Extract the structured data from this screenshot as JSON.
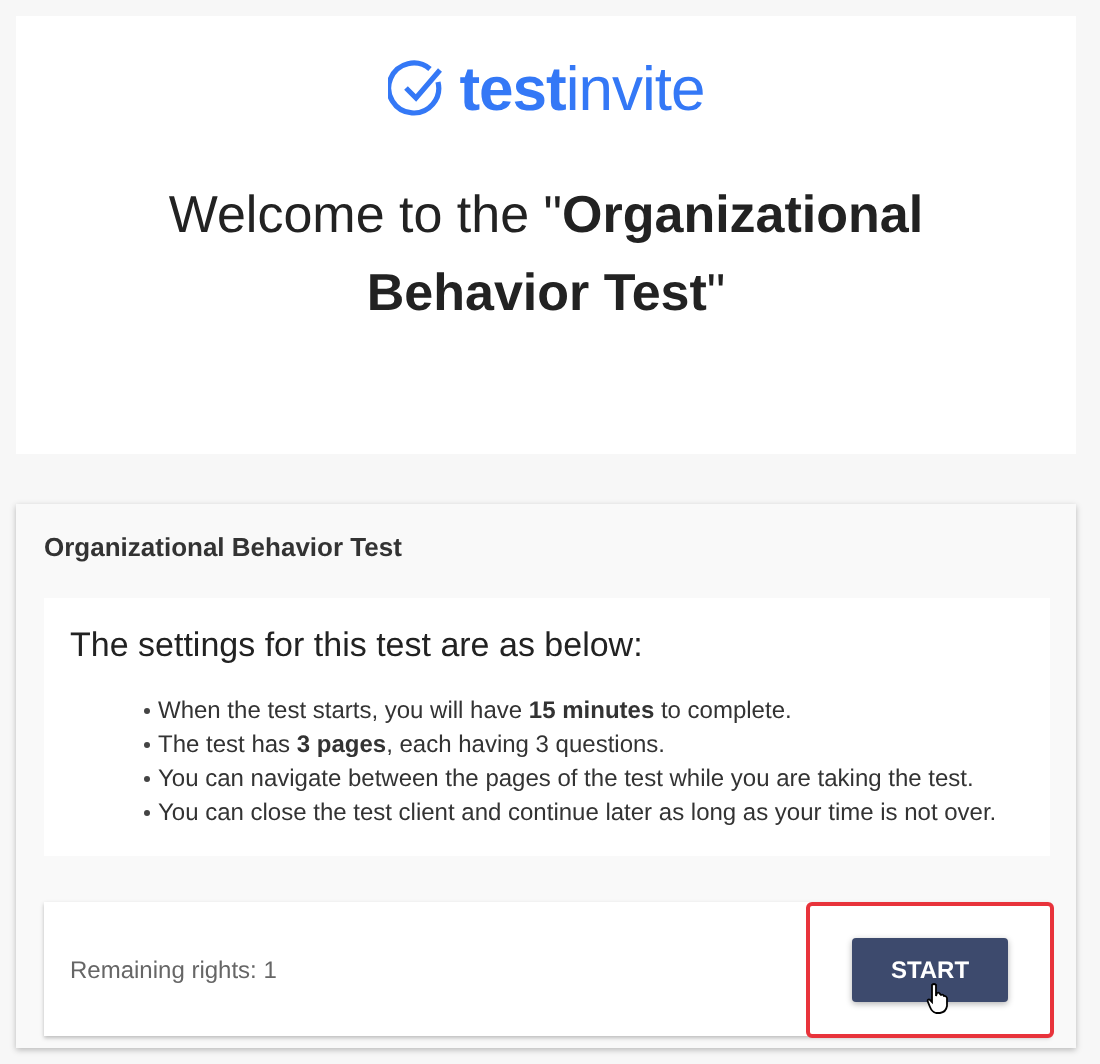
{
  "logo": {
    "text": "**test**invite"
  },
  "welcome": {
    "heading": "Welcome to the \"**Organizational Behavior Test**\""
  },
  "test_card": {
    "title": "Organizational Behavior Test",
    "settings_heading": "The settings for this test are as below:",
    "settings": [
      "When the test starts, you will have **15 minutes** to complete.",
      "The test has **3 pages**, each having 3 questions.",
      "You can navigate between the pages of the test while you are taking the test.",
      "You can close the test client and continue later as long as your time is not over."
    ],
    "remaining_rights": "Remaining rights: 1",
    "start_button": {
      "label": "START",
      "highlighted": true
    }
  }
}
